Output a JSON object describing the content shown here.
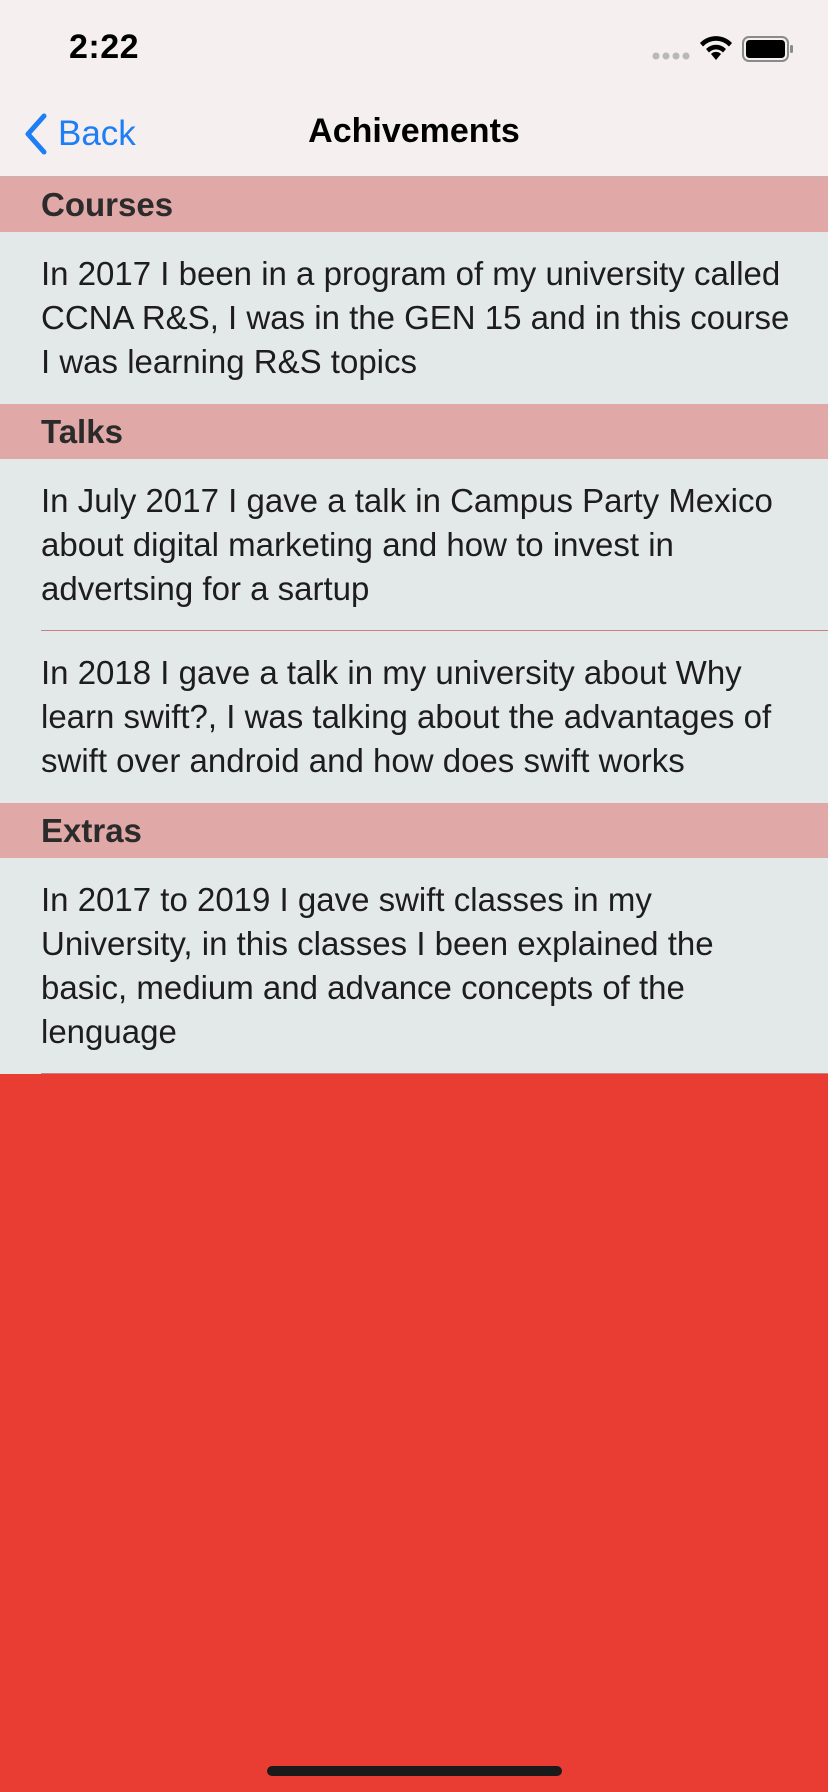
{
  "status_bar": {
    "time": "2:22"
  },
  "nav": {
    "back_label": "Back",
    "title": "Achivements"
  },
  "sections": [
    {
      "header": "Courses",
      "items": [
        "In 2017 I been in a program of my university called CCNA R&S, I was in the GEN 15 and in this course I was learning R&S topics"
      ]
    },
    {
      "header": "Talks",
      "items": [
        "In July 2017 I gave a talk in Campus Party Mexico about digital marketing and how to invest in advertsing for a sartup",
        "In 2018 I gave a talk in my university about Why learn swift?, I was talking about the advantages of swift over android and how does swift works"
      ]
    },
    {
      "header": "Extras",
      "items": [
        "In 2017 to 2019 I gave swift classes in my University, in this classes I been explained the basic, medium and advance concepts of the lenguage"
      ]
    }
  ],
  "colors": {
    "background": "#e93c33",
    "bar": "#f5efef",
    "section_header": "#e0a8a6",
    "cell": "#e3e8e8",
    "accent": "#1e7ef4"
  }
}
